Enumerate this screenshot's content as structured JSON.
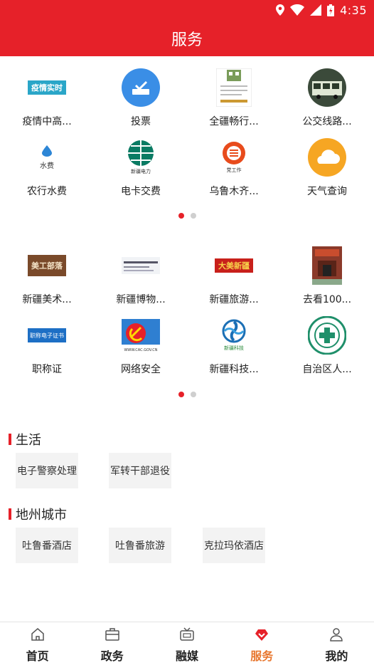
{
  "status": {
    "time": "4:35"
  },
  "header": {
    "title": "服务"
  },
  "grid1": {
    "items": [
      {
        "label": "疫情中高...",
        "icon": "epidemic-realtime-logo",
        "logo_text": "疫情实时"
      },
      {
        "label": "投票",
        "icon": "vote-icon"
      },
      {
        "label": "全疆畅行...",
        "icon": "qr-code-thumbnail"
      },
      {
        "label": "公交线路...",
        "icon": "bus-photo"
      },
      {
        "label": "农行水费",
        "icon": "water-fee-icon",
        "logo_text": "水费"
      },
      {
        "label": "电卡交费",
        "icon": "state-grid-logo",
        "logo_text": "新疆电力"
      },
      {
        "label": "乌鲁木齐...",
        "icon": "urumqi-service-logo",
        "logo_text": "党工作"
      },
      {
        "label": "天气查询",
        "icon": "weather-icon"
      }
    ],
    "page_active": 0,
    "page_count": 2
  },
  "grid2": {
    "items": [
      {
        "label": "新疆美术...",
        "icon": "art-calligraphy-logo",
        "logo_text": "美工部落"
      },
      {
        "label": "新疆博物...",
        "icon": "museum-logo"
      },
      {
        "label": "新疆旅游...",
        "icon": "tourism-calligraphy-logo",
        "logo_text": "大美新疆"
      },
      {
        "label": "去看100...",
        "icon": "red-building-photo"
      },
      {
        "label": "职称证",
        "icon": "certificate-banner",
        "logo_text": "职称电子证书"
      },
      {
        "label": "网络安全",
        "icon": "cac-banner",
        "logo_text": "WWW.CAC.GOV.CN"
      },
      {
        "label": "新疆科技...",
        "icon": "science-spiral-logo",
        "logo_text": "新疆科技"
      },
      {
        "label": "自治区人...",
        "icon": "hospital-round-logo"
      }
    ],
    "page_active": 0,
    "page_count": 2
  },
  "sections": [
    {
      "title": "生活",
      "chips": [
        "电子警察处理",
        "军转干部退役"
      ]
    },
    {
      "title": "地州城市",
      "chips": [
        "吐鲁番酒店",
        "吐鲁番旅游",
        "克拉玛依酒店"
      ]
    }
  ],
  "tabbar": {
    "active_index": 3,
    "tabs": [
      {
        "label": "首页",
        "icon": "home-icon"
      },
      {
        "label": "政务",
        "icon": "briefcase-icon"
      },
      {
        "label": "融媒",
        "icon": "tv-icon"
      },
      {
        "label": "服务",
        "icon": "service-heart-icon"
      },
      {
        "label": "我的",
        "icon": "person-icon"
      }
    ]
  },
  "colors": {
    "brand": "#e62129",
    "active_tab": "#e8772e",
    "chip_bg": "#f3f3f3"
  }
}
